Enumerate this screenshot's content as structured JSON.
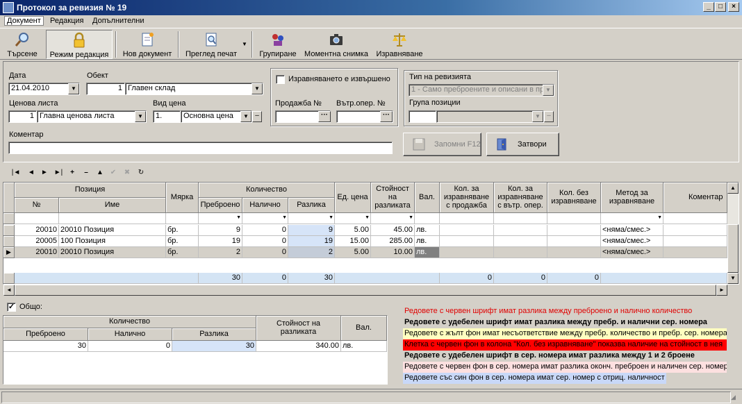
{
  "window": {
    "title": "Протокол за ревизия № 19"
  },
  "menu": [
    "Документ",
    "Редакция",
    "Допълнителни"
  ],
  "toolbar": {
    "search": "Търсене",
    "edit_mode": "Режим редакция",
    "new_doc": "Нов документ",
    "print_preview": "Преглед печат",
    "group": "Групиране",
    "snapshot": "Моментна снимка",
    "align": "Изравняване"
  },
  "form": {
    "date_label": "Дата",
    "date_value": "21.04.2010",
    "object_label": "Обект",
    "object_code": "1",
    "object_name": "Главен склад",
    "pricelist_label": "Ценова листа",
    "pricelist_code": "1",
    "pricelist_name": "Главна ценова листа",
    "price_type_label": "Вид цена",
    "price_type_code": "1.",
    "price_type_name": "Основна цена",
    "comment_label": "Коментар",
    "comment_value": "",
    "aligned_label": "Изравняването е извършено",
    "sale_label": "Продажба №",
    "internal_label": "Вътр.опер. №",
    "revision_type_label": "Тип на ревизията",
    "revision_type_value": "1 - Само преброените и описани в пр",
    "position_group_label": "Група позиции",
    "save_button": "Запомни  F12",
    "close_button": "Затвори"
  },
  "grid": {
    "headers": {
      "position": "Позиция",
      "no": "№",
      "name": "Име",
      "unit": "Мярка",
      "quantity": "Количество",
      "counted": "Преброено",
      "available": "Налично",
      "difference": "Разлика",
      "unit_price": "Ед. цена",
      "diff_value": "Стойност на разликата",
      "currency": "Вал.",
      "qty_sale": "Кол. за изравняване с продажба",
      "qty_internal": "Кол. за изравняване с вътр. опер.",
      "qty_noalign": "Кол. без изравняване",
      "method": "Метод за изравняване",
      "comment": "Коментар"
    },
    "rows": [
      {
        "no": "20010",
        "name": "20010 Позиция",
        "unit": "бр.",
        "counted": "9",
        "available": "0",
        "difference": "9",
        "unit_price": "5.00",
        "diff_value": "45.00",
        "currency": "лв.",
        "method": "<няма/смес.>"
      },
      {
        "no": "20005",
        "name": "100 Позиция",
        "unit": "бр.",
        "counted": "19",
        "available": "0",
        "difference": "19",
        "unit_price": "15.00",
        "diff_value": "285.00",
        "currency": "лв.",
        "method": "<няма/смес.>"
      },
      {
        "no": "20010",
        "name": "20010 Позиция",
        "unit": "бр.",
        "counted": "2",
        "available": "0",
        "difference": "2",
        "unit_price": "5.00",
        "diff_value": "10.00",
        "currency": "лв.",
        "method": "<няма/смес.>"
      }
    ],
    "totals": {
      "counted": "30",
      "available": "0",
      "difference": "30",
      "qty_sale": "0",
      "qty_internal": "0",
      "qty_noalign": "0"
    }
  },
  "summary": {
    "total_label": "Общо:",
    "quantity": "Количество",
    "counted": "Преброено",
    "available": "Налично",
    "difference": "Разлика",
    "diff_value": "Стойност на разликата",
    "currency": "Вал.",
    "row": {
      "counted": "30",
      "available": "0",
      "difference": "30",
      "diff_value": "340.00",
      "currency": "лв."
    }
  },
  "legend": [
    "Редовете с червен шрифт имат разлика между преброено и налично количество",
    "Редовете с удебелен шрифт имат разлика между пребр. и налични сер. номера",
    "Редовете с жълт фон имат несъответствие между пребр. количество и пребр. сер. номера",
    "Клетка с червен фон в колона \"Кол. без изравняване\" показва наличие на стойност в нея",
    "Редовете с удебелен шрифт в сер. номера имат разлика между 1 и 2 броене",
    "Редовете с червен фон в сер. номера имат разлика оконч. преброен и наличен сер. номер",
    "Редовете със син фон в сер. номера имат сер. номер с отриц. наличност"
  ],
  "colors": {
    "title_bar": "#0a246a",
    "diff_highlight": "#d6e4f8",
    "legend_red": "#ff0000",
    "legend_yellow": "#ffffc0",
    "legend_pink": "#fde0e0",
    "legend_blue": "#c8d8f8"
  }
}
